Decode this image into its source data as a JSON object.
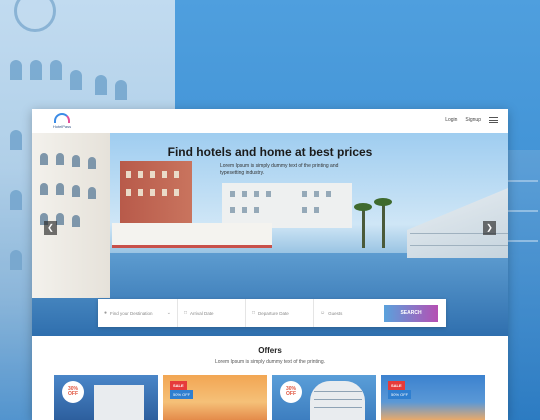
{
  "brand": {
    "name": "HotelPass",
    "accent": "#3c8ce6",
    "accent2": "#e44f9a"
  },
  "nav": {
    "login": "Login",
    "signup": "Signup"
  },
  "hero": {
    "title": "Find hotels and home at best prices",
    "subtitle": "Lorem Ipsum is simply dummy text of the printing and typesetting industry."
  },
  "search": {
    "destination_placeholder": "Find your Destination",
    "arrival_placeholder": "Arrival Date",
    "departure_placeholder": "Departure Date",
    "guests_placeholder": "Guests",
    "button_label": "SEARCH",
    "button_colors": [
      "#5aa2dc",
      "#b54fb3"
    ]
  },
  "offers": {
    "title": "Offers",
    "subtitle": "Lorem Ipsum is simply dummy text of the printing.",
    "cards": [
      {
        "badge_pct": "30%",
        "badge_word": "OFF"
      },
      {
        "ribbon": "SALE",
        "ribbon2": "50% OFF"
      },
      {
        "badge_pct": "30%",
        "badge_word": "OFF"
      },
      {
        "ribbon": "SALE",
        "ribbon2": "50% OFF"
      }
    ]
  }
}
